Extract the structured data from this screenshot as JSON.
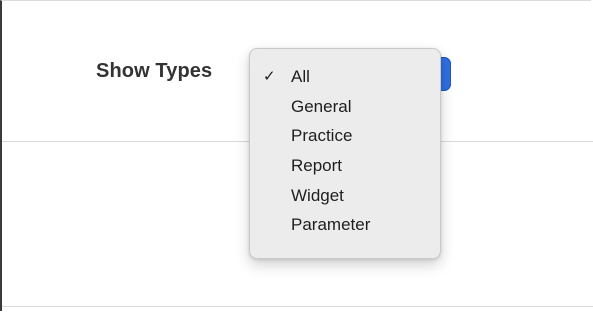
{
  "filter": {
    "label": "Show Types",
    "selected": "All"
  },
  "menu": {
    "items": [
      {
        "label": "All",
        "check": "✓"
      },
      {
        "label": "General",
        "check": ""
      },
      {
        "label": "Practice",
        "check": ""
      },
      {
        "label": "Report",
        "check": ""
      },
      {
        "label": "Widget",
        "check": ""
      },
      {
        "label": "Parameter",
        "check": ""
      }
    ]
  },
  "colors": {
    "select_accent": "#2f6fe0",
    "menu_background": "#ececec",
    "label_text": "#333333"
  }
}
